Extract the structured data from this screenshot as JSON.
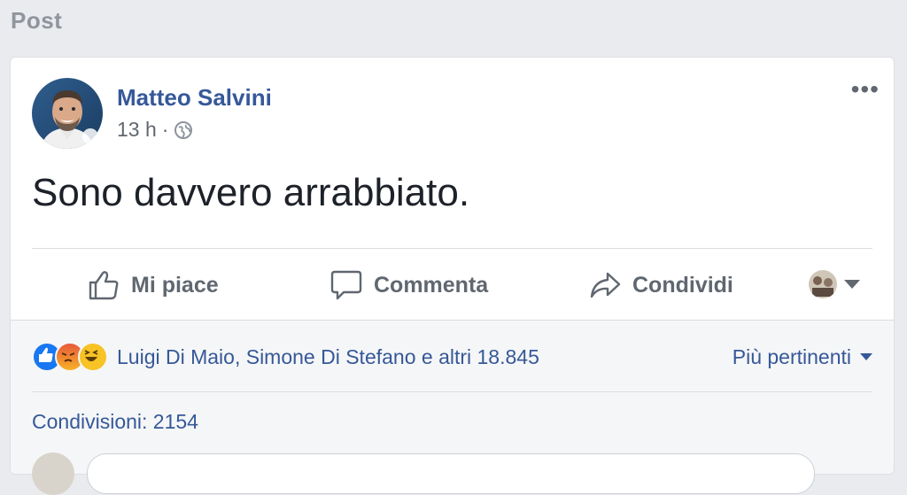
{
  "page": {
    "section_title": "Post"
  },
  "post": {
    "author": "Matteo Salvini",
    "timestamp": "13 h",
    "separator": "·",
    "privacy_icon": "globe-icon",
    "more_icon": "•••",
    "text": "Sono davvero arrabbiato."
  },
  "actions": {
    "like_label": "Mi piace",
    "comment_label": "Commenta",
    "share_label": "Condividi"
  },
  "reactions": {
    "types": [
      "like",
      "angry",
      "haha"
    ],
    "summary": "Luigi Di Maio, Simone Di Stefano e altri 18.845",
    "sort_label": "Più pertinenti"
  },
  "shares": {
    "label": "Condivisioni: 2154"
  },
  "colors": {
    "link": "#365899",
    "like": "#1877f2",
    "angry": "#e9710f",
    "haha": "#f7b125",
    "text": "#1d2129",
    "muted": "#616770"
  }
}
